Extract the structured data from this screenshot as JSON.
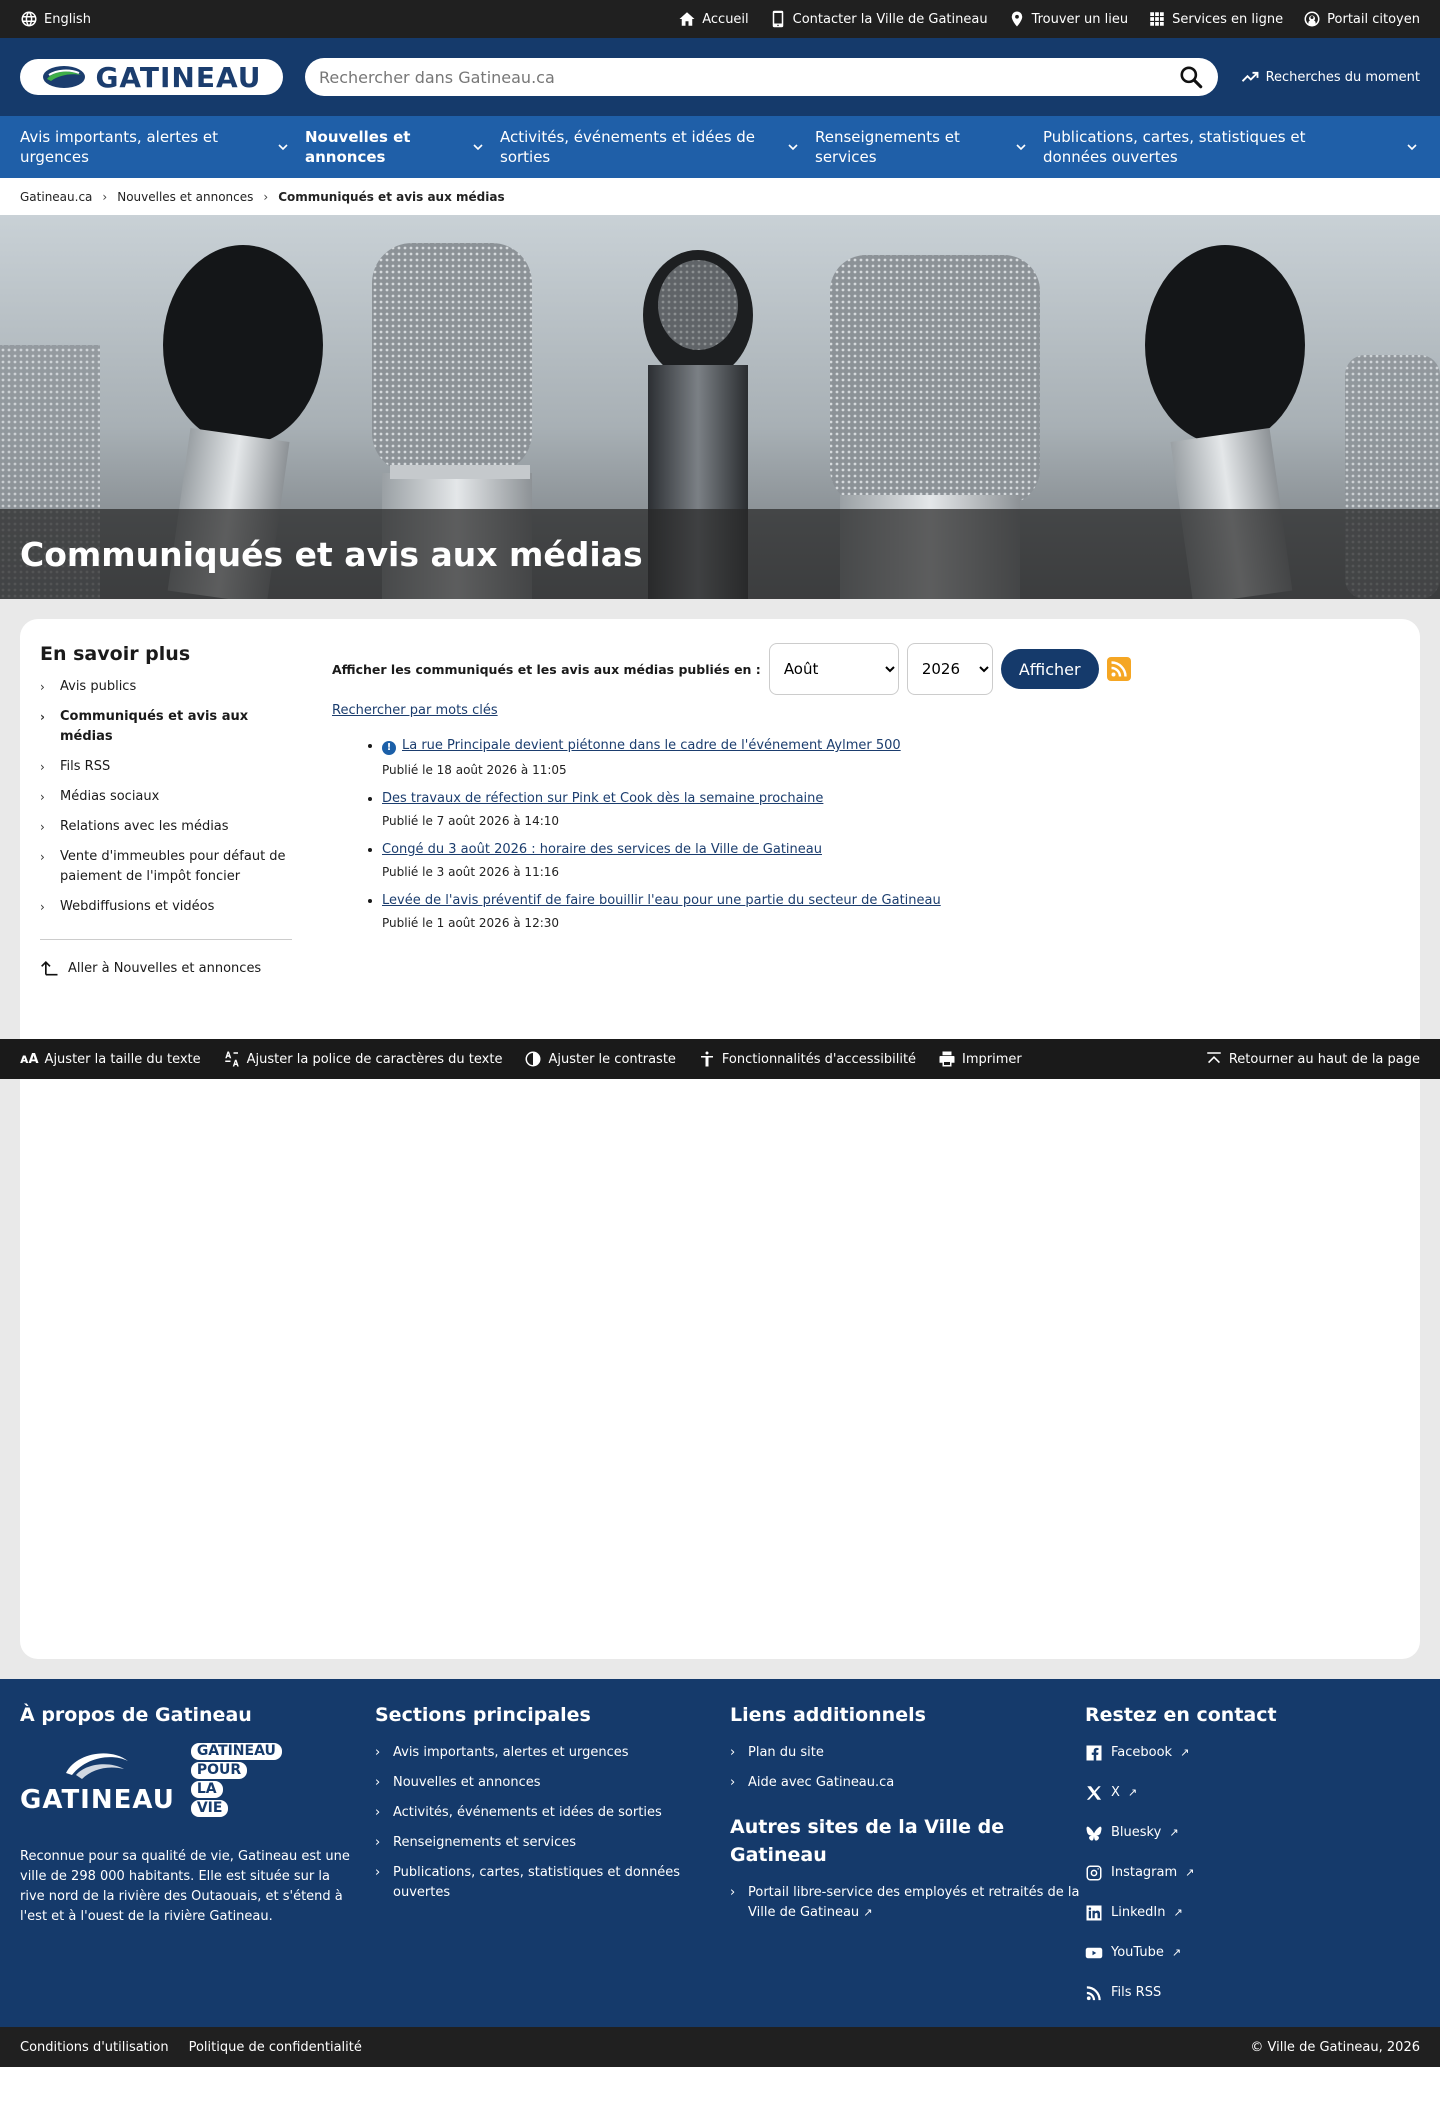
{
  "utility": {
    "language": "English",
    "links": [
      "Accueil",
      "Contacter la Ville de Gatineau",
      "Trouver un lieu",
      "Services en ligne",
      "Portail citoyen"
    ]
  },
  "header": {
    "logo_text": "GATINEAU",
    "search_placeholder": "Rechercher dans Gatineau.ca",
    "trending": "Recherches du moment"
  },
  "nav": [
    "Avis importants, alertes et urgences",
    "Nouvelles et annonces",
    "Activités, événements et idées de sorties",
    "Renseignements et services",
    "Publications, cartes, statistiques et données ouvertes"
  ],
  "breadcrumb": [
    "Gatineau.ca",
    "Nouvelles et annonces",
    "Communiqués et avis aux médias"
  ],
  "hero": {
    "title": "Communiqués et avis aux médias"
  },
  "sidebar": {
    "title": "En savoir plus",
    "items": [
      "Avis publics",
      "Communiqués et avis aux médias",
      "Fils RSS",
      "Médias sociaux",
      "Relations avec les médias",
      "Vente d'immeubles pour défaut de paiement de l'impôt foncier",
      "Webdiffusions et vidéos"
    ],
    "back": "Aller à Nouvelles et annonces"
  },
  "filter": {
    "label": "Afficher les communiqués et les avis aux médias publiés en :",
    "month": "Août",
    "year": "2026",
    "button": "Afficher",
    "keyword_link": "Rechercher par mots clés"
  },
  "news": [
    {
      "title": "La rue Principale devient piétonne dans le cadre de l'événement Aylmer 500",
      "date": "Publié le 18 août 2026 à 11:05"
    },
    {
      "title": "Des travaux de réfection sur Pink et Cook dès la semaine prochaine",
      "date": "Publié le 7 août 2026 à 14:10"
    },
    {
      "title": "Congé du 3 août 2026 : horaire des services de la Ville de Gatineau",
      "date": "Publié le 3 août 2026 à 11:16"
    },
    {
      "title": "Levée de l'avis préventif de faire bouillir l'eau pour une partie du secteur de Gatineau",
      "date": "Publié le 1 août 2026 à 12:30"
    }
  ],
  "a11y": {
    "items": [
      "Ajuster la taille du texte",
      "Ajuster la police de caractères du texte",
      "Ajuster le contraste",
      "Fonctionnalités d'accessibilité",
      "Imprimer"
    ],
    "top": "Retourner au haut de la page"
  },
  "footer": {
    "about_title": "À propos de Gatineau",
    "logo_text": "GATINEAU",
    "slogan": [
      "GATINEAU",
      "POUR",
      "LA",
      "VIE"
    ],
    "about_text": "Reconnue pour sa qualité de vie, Gatineau est une ville de 298 000 habitants. Elle est située sur la rive nord de la rivière des Outaouais, et s'étend à l'est et à l'ouest de la rivière Gatineau.",
    "sections_title": "Sections principales",
    "sections": [
      "Avis importants, alertes et urgences",
      "Nouvelles et annonces",
      "Activités, événements et idées de sorties",
      "Renseignements et services",
      "Publications, cartes, statistiques et données ouvertes"
    ],
    "links_title": "Liens additionnels",
    "links": [
      "Plan du site",
      "Aide avec Gatineau.ca"
    ],
    "other_title": "Autres sites de la Ville de Gatineau",
    "other": [
      "Portail libre-service des employés et retraités de la Ville de Gatineau"
    ],
    "contact_title": "Restez en contact",
    "social": [
      "Facebook",
      "X",
      "Bluesky",
      "Instagram",
      "LinkedIn",
      "YouTube",
      "Fils RSS"
    ]
  },
  "bottom": {
    "terms": "Conditions d'utilisation",
    "privacy": "Politique de confidentialité",
    "copyright": "© Ville de Gatineau, 2026"
  },
  "colors": {
    "header": "#153a6b",
    "nav": "#1f5fa8",
    "rss": "#f5a623"
  }
}
